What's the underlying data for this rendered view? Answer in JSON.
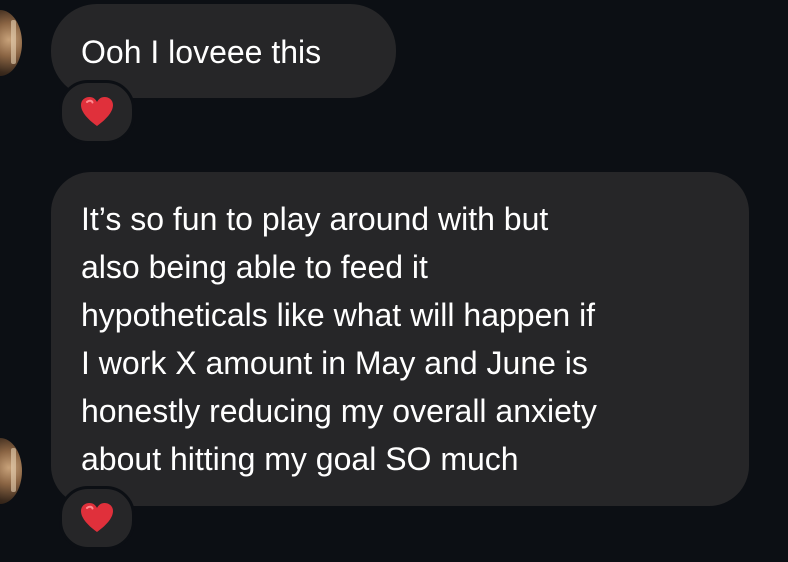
{
  "messages": [
    {
      "text": "Ooh I loveee this",
      "reaction": "heart-emoji"
    },
    {
      "lines": [
        "It’s so fun to play around with but",
        "also being able to feed it",
        "hypotheticals like what will happen if",
        "I work X amount in May and June is",
        "honestly reducing my overall anxiety",
        "about hitting my goal SO much"
      ],
      "reaction": "heart-emoji"
    }
  ],
  "colors": {
    "background": "#0c0f14",
    "bubble": "#262628",
    "text": "#ffffff",
    "heart": "#e0303b"
  }
}
